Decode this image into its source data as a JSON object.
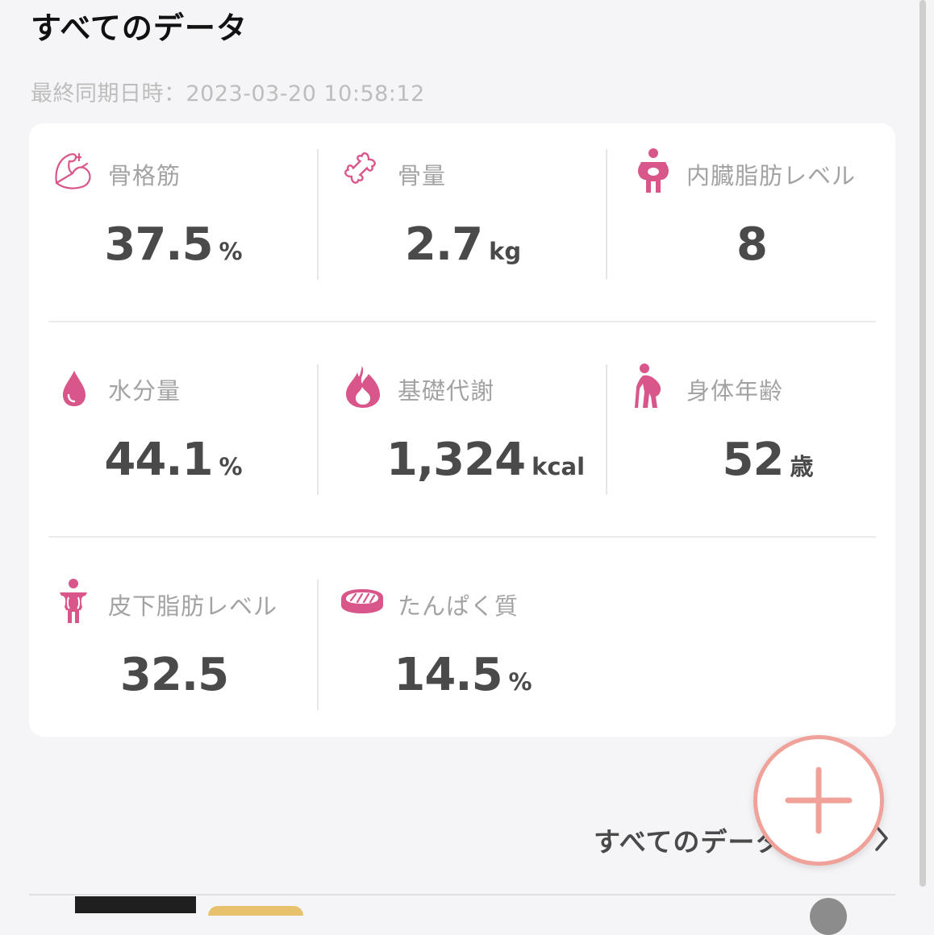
{
  "header": {
    "title": "すべてのデータ",
    "sync_label": "最終同期日時：2023-03-20 10:58:12"
  },
  "metrics": [
    {
      "label": "骨格筋",
      "value": "37.5",
      "unit": "%",
      "icon": "muscle-icon"
    },
    {
      "label": "骨量",
      "value": "2.7",
      "unit": "kg",
      "icon": "bone-icon"
    },
    {
      "label": "内臓脂肪レベル",
      "value": "8",
      "unit": "",
      "icon": "visceral-fat-icon"
    },
    {
      "label": "水分量",
      "value": "44.1",
      "unit": "%",
      "icon": "water-drop-icon"
    },
    {
      "label": "基礎代謝",
      "value": "1,324",
      "unit": "kcal",
      "icon": "flame-icon"
    },
    {
      "label": "身体年齢",
      "value": "52",
      "unit": "歳",
      "icon": "elderly-person-icon"
    },
    {
      "label": "皮下脂肪レベル",
      "value": "32.5",
      "unit": "",
      "icon": "subcutaneous-fat-icon"
    },
    {
      "label": "たんぱく質",
      "value": "14.5",
      "unit": "%",
      "icon": "steak-icon"
    }
  ],
  "footer": {
    "all_data_link": "すべてのデータ"
  },
  "colors": {
    "accent": "#d9568a",
    "fab": "#f0a29a",
    "value_text": "#4a4a4a",
    "label_text": "#a3a3a3"
  }
}
